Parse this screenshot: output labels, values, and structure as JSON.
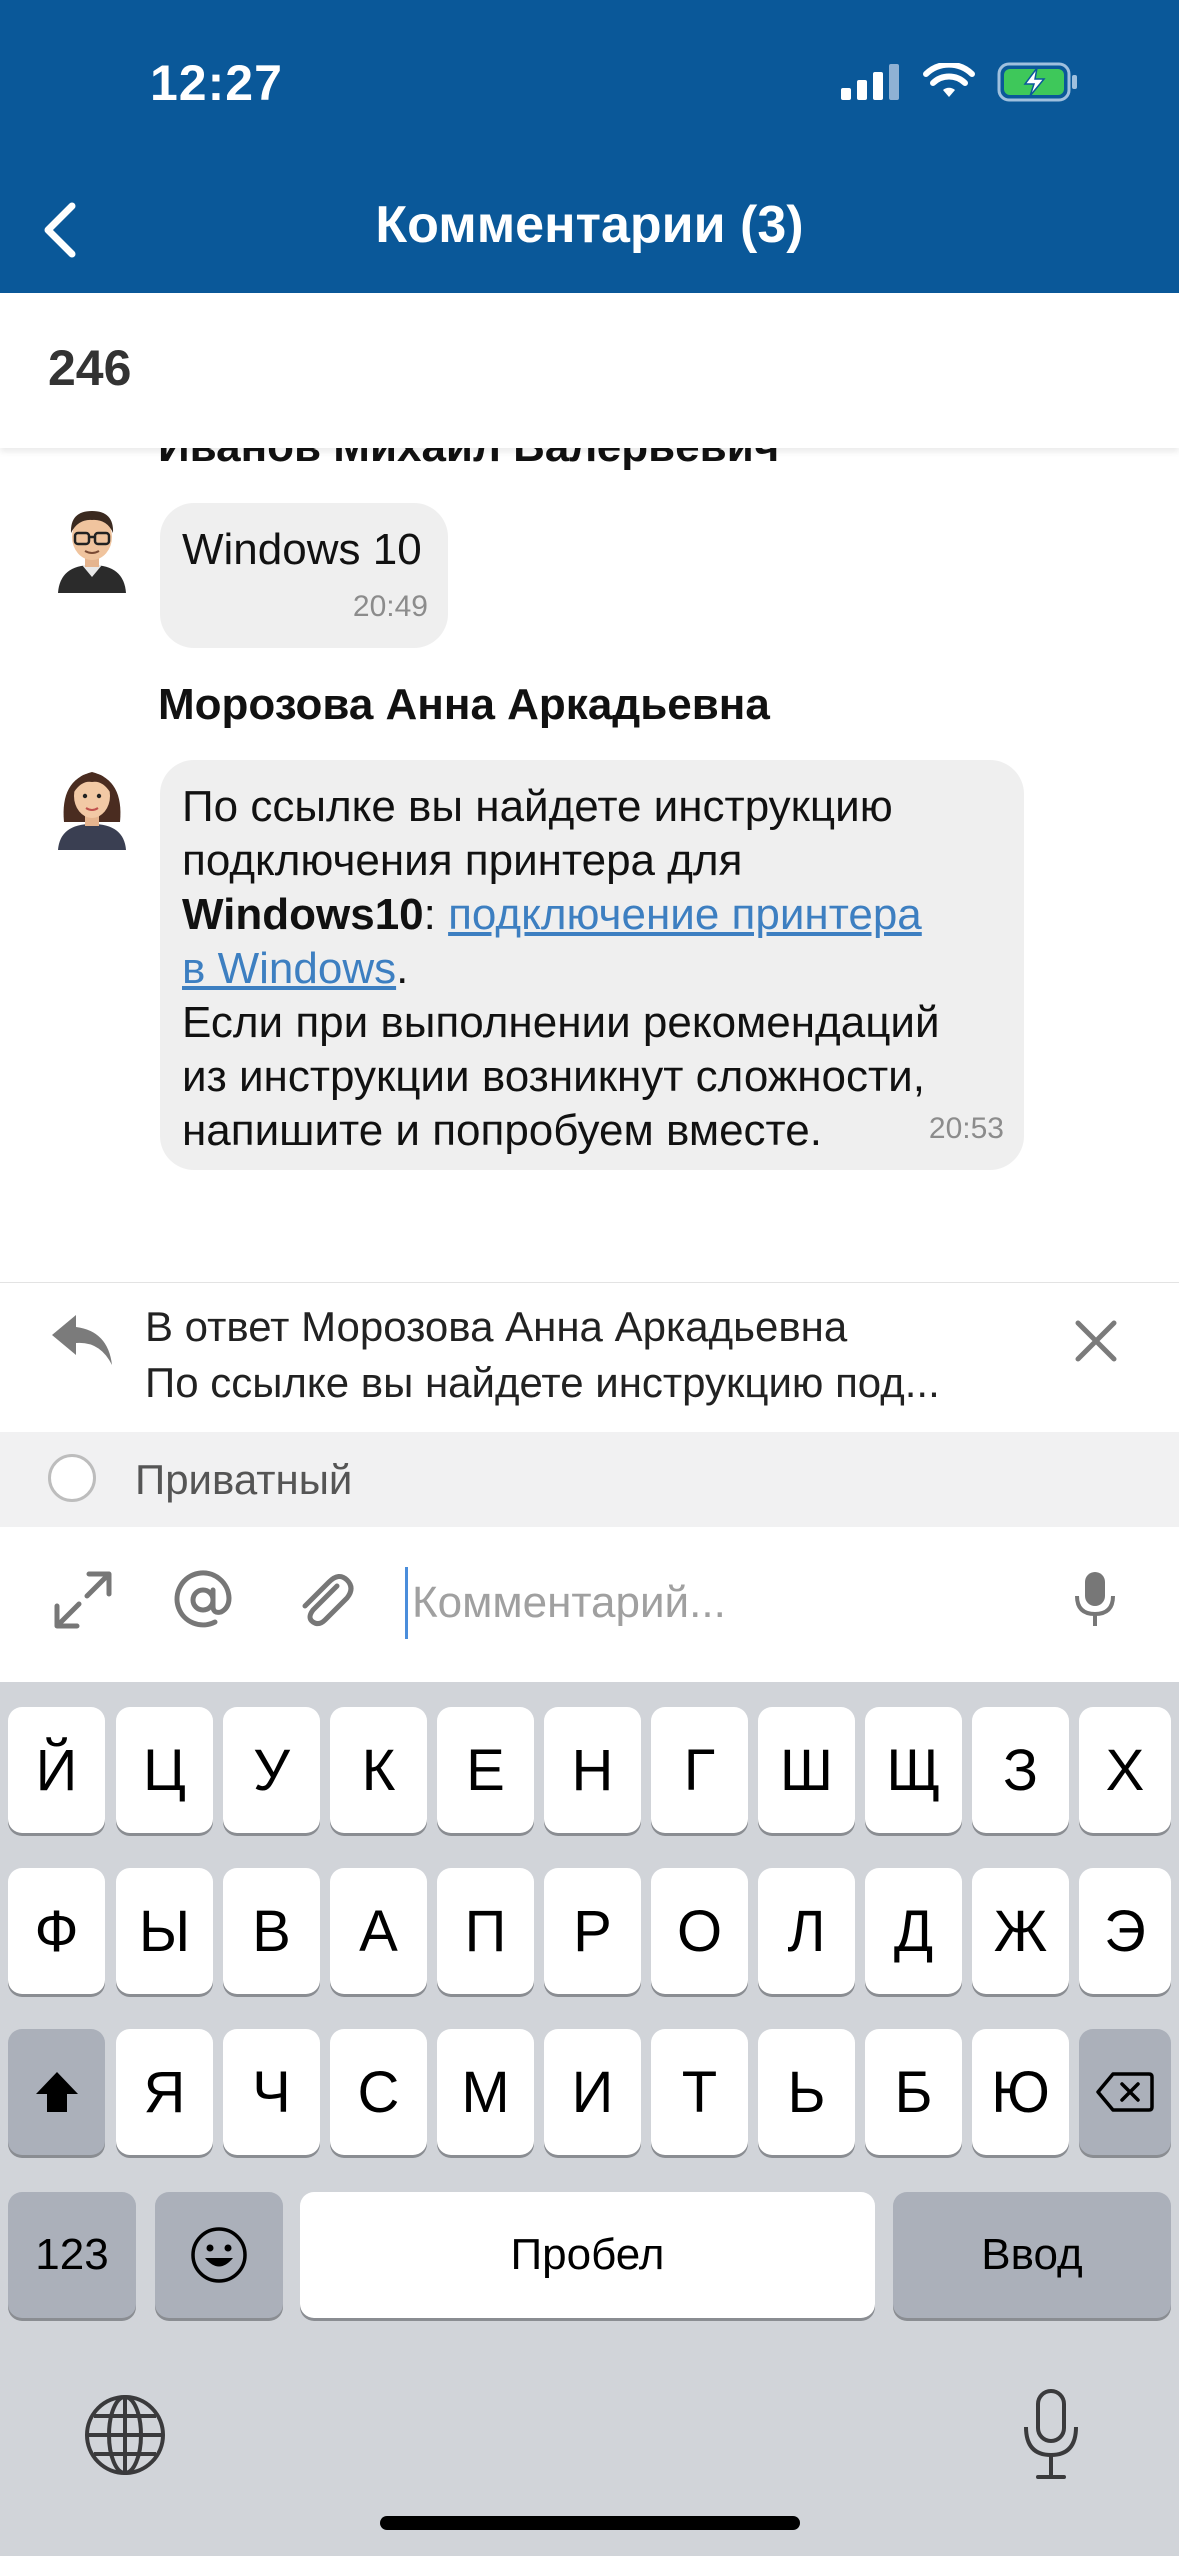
{
  "status_bar": {
    "time": "12:27"
  },
  "header": {
    "title": "Комментарии (3)"
  },
  "ticket": {
    "number": "246"
  },
  "messages": [
    {
      "author": "Иванов Михаил Валерьевич",
      "text": "Windows 10",
      "time": "20:49"
    },
    {
      "author": "Морозова Анна Аркадьевна",
      "line1": "По ссылке вы найдете инструкцию",
      "line2": "подключения принтера для",
      "bold": "Windows10",
      "colon": ": ",
      "link_part1": "подключение принтера",
      "link_part2": "в Windows",
      "dot": ".",
      "line5": "Если при выполнении рекомендаций",
      "line6": "из инструкции возникнут сложности,",
      "line7": "напишите и попробуем вместе.",
      "time": "20:53"
    }
  ],
  "reply": {
    "title": "В ответ Морозова Анна Аркадьевна",
    "text": "По ссылке вы найдете инструкцию под..."
  },
  "private_toggle": {
    "label": "Приватный"
  },
  "composer": {
    "placeholder": "Комментарий..."
  },
  "keyboard": {
    "row1": [
      "Й",
      "Ц",
      "У",
      "К",
      "Е",
      "Н",
      "Г",
      "Ш",
      "Щ",
      "З",
      "Х"
    ],
    "row2": [
      "Ф",
      "Ы",
      "В",
      "А",
      "П",
      "Р",
      "О",
      "Л",
      "Д",
      "Ж",
      "Э"
    ],
    "row3": [
      "Я",
      "Ч",
      "С",
      "М",
      "И",
      "Т",
      "Ь",
      "Б",
      "Ю"
    ],
    "numbers_key": "123",
    "space_key": "Пробел",
    "return_key": "Ввод"
  },
  "colors": {
    "header": "#0a5899",
    "link": "#3d7fc1",
    "bubble": "#efefef",
    "keyboard": "#d1d4d9"
  }
}
